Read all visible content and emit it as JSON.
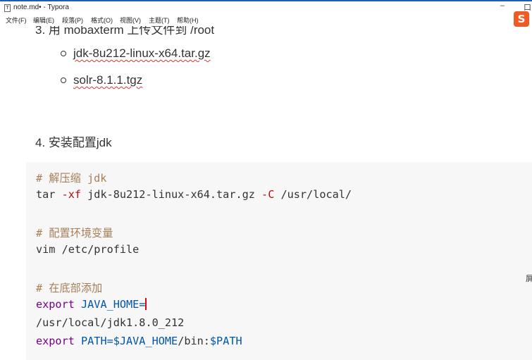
{
  "window": {
    "title": "note.md• - Typora",
    "icon": "typora-app-icon",
    "controls": {
      "minimize": "–",
      "maximize_partial": "口"
    }
  },
  "menu": [
    "文件(F)",
    "编辑(E)",
    "段落(P)",
    "格式(O)",
    "视图(V)",
    "主题(T)",
    "帮助(H)"
  ],
  "ime_badge": "S",
  "edge_char": "屏",
  "doc": {
    "partial_heading": "3. 用 mobaxterm 上传文件到 /root",
    "list_items": [
      "jdk-8u212-linux-x64.tar.gz",
      "solr-8.1.1.tgz"
    ],
    "heading4": "4. 安装配置jdk"
  },
  "code": {
    "c1": "# 解压缩 jdk",
    "l2_cmd": "tar ",
    "l2_opt1": "-xf",
    "l2_mid": " jdk-8u212-linux-x64.tar.gz ",
    "l2_opt2": "-C",
    "l2_tail": " /usr/local/",
    "c2": "# 配置环境变量",
    "l4": "vim /etc/profile",
    "c3": "# 在底部添加",
    "l6_kw": "export",
    "l6_var": " JAVA_HOME=",
    "l7": "/usr/local/jdk1.8.0_212",
    "l8_kw": "export",
    "l8_var": " PATH=$JAVA_HOME",
    "l8_mid": "/bin:",
    "l8_var2": "$PATH"
  }
}
